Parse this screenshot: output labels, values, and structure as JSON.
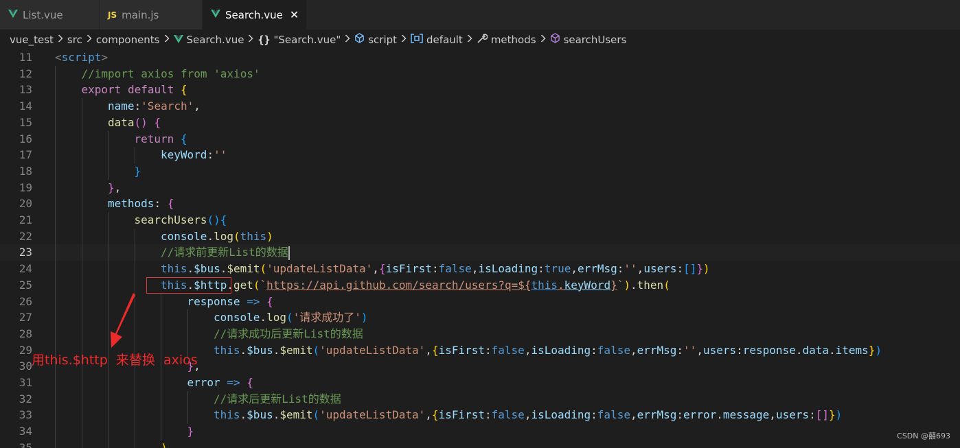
{
  "tabs": [
    {
      "label": "List.vue",
      "icon": "vue-icon",
      "active": false
    },
    {
      "label": "main.js",
      "icon": "js-icon",
      "active": false
    },
    {
      "label": "Search.vue",
      "icon": "vue-icon",
      "active": true
    }
  ],
  "tab_js_glyph": "JS",
  "tab_close_glyph": "✕",
  "breadcrumb": [
    {
      "label": "vue_test",
      "icon": ""
    },
    {
      "label": "src",
      "icon": ""
    },
    {
      "label": "components",
      "icon": ""
    },
    {
      "label": "Search.vue",
      "icon": "vue-icon"
    },
    {
      "label": "\"Search.vue\"",
      "icon": "braces-icon"
    },
    {
      "label": "script",
      "icon": "cube-icon"
    },
    {
      "label": "default",
      "icon": "module-icon"
    },
    {
      "label": "methods",
      "icon": "wrench-icon"
    },
    {
      "label": "searchUsers",
      "icon": "method-cube-icon"
    }
  ],
  "code": {
    "current_line": 23,
    "lines": [
      {
        "n": "11",
        "indent": 0,
        "t": [
          [
            "tag",
            "<"
          ],
          [
            "tagname",
            "script"
          ],
          [
            "tag",
            ">"
          ]
        ]
      },
      {
        "n": "12",
        "indent": 1,
        "t": [
          [
            "cm",
            "//import axios from 'axios'"
          ]
        ]
      },
      {
        "n": "13",
        "indent": 1,
        "t": [
          [
            "kw",
            "export"
          ],
          [
            "plain",
            " "
          ],
          [
            "kw",
            "default"
          ],
          [
            "plain",
            " "
          ],
          [
            "p1",
            "{"
          ]
        ]
      },
      {
        "n": "14",
        "indent": 2,
        "t": [
          [
            "prop",
            "name"
          ],
          [
            "plain",
            ":"
          ],
          [
            "str",
            "'Search'"
          ],
          [
            "plain",
            ","
          ]
        ]
      },
      {
        "n": "15",
        "indent": 2,
        "t": [
          [
            "fn",
            "data"
          ],
          [
            "p2",
            "()"
          ],
          [
            "plain",
            " "
          ],
          [
            "p2",
            "{"
          ]
        ]
      },
      {
        "n": "16",
        "indent": 3,
        "t": [
          [
            "kw",
            "return"
          ],
          [
            "plain",
            " "
          ],
          [
            "p3",
            "{"
          ]
        ]
      },
      {
        "n": "17",
        "indent": 4,
        "t": [
          [
            "prop",
            "keyWord"
          ],
          [
            "plain",
            ":"
          ],
          [
            "str",
            "''"
          ]
        ]
      },
      {
        "n": "18",
        "indent": 3,
        "t": [
          [
            "p3",
            "}"
          ]
        ]
      },
      {
        "n": "19",
        "indent": 2,
        "t": [
          [
            "p2",
            "}"
          ],
          [
            "plain",
            ","
          ]
        ]
      },
      {
        "n": "20",
        "indent": 2,
        "t": [
          [
            "prop",
            "methods"
          ],
          [
            "plain",
            ": "
          ],
          [
            "p2",
            "{"
          ]
        ]
      },
      {
        "n": "21",
        "indent": 3,
        "t": [
          [
            "fn",
            "searchUsers"
          ],
          [
            "p3",
            "()"
          ],
          [
            "p3",
            "{"
          ]
        ]
      },
      {
        "n": "22",
        "indent": 4,
        "t": [
          [
            "prop",
            "console"
          ],
          [
            "plain",
            "."
          ],
          [
            "fn",
            "log"
          ],
          [
            "p1",
            "("
          ],
          [
            "this",
            "this"
          ],
          [
            "p1",
            ")"
          ]
        ]
      },
      {
        "n": "23",
        "indent": 4,
        "t": [
          [
            "cm",
            "//请求前更新List的数据"
          ],
          [
            "cursor",
            ""
          ]
        ]
      },
      {
        "n": "24",
        "indent": 4,
        "t": [
          [
            "this",
            "this"
          ],
          [
            "plain",
            "."
          ],
          [
            "prop",
            "$bus"
          ],
          [
            "plain",
            "."
          ],
          [
            "fn",
            "$emit"
          ],
          [
            "p1",
            "("
          ],
          [
            "str",
            "'updateListData'"
          ],
          [
            "plain",
            ","
          ],
          [
            "p2",
            "{"
          ],
          [
            "prop",
            "isFirst"
          ],
          [
            "plain",
            ":"
          ],
          [
            "bool",
            "false"
          ],
          [
            "plain",
            ","
          ],
          [
            "prop",
            "isLoading"
          ],
          [
            "plain",
            ":"
          ],
          [
            "bool",
            "true"
          ],
          [
            "plain",
            ","
          ],
          [
            "prop",
            "errMsg"
          ],
          [
            "plain",
            ":"
          ],
          [
            "str",
            "''"
          ],
          [
            "plain",
            ","
          ],
          [
            "prop",
            "users"
          ],
          [
            "plain",
            ":"
          ],
          [
            "p3",
            "[]"
          ],
          [
            "p2",
            "}"
          ],
          [
            "p1",
            ")"
          ]
        ]
      },
      {
        "n": "25",
        "indent": 4,
        "t": [
          [
            "this",
            "this"
          ],
          [
            "plain",
            "."
          ],
          [
            "prop",
            "$http"
          ],
          [
            "plain",
            "."
          ],
          [
            "fn",
            "get"
          ],
          [
            "p1",
            "("
          ],
          [
            "str",
            "`"
          ],
          [
            "strlink",
            "https://api.github.com/search/users?q=${"
          ],
          [
            "thislink",
            "this"
          ],
          [
            "strlink",
            "."
          ],
          [
            "proplink",
            "keyWord"
          ],
          [
            "strlink",
            "}"
          ],
          [
            "str",
            "`"
          ],
          [
            "p1",
            ")"
          ],
          [
            "plain",
            "."
          ],
          [
            "fn",
            "then"
          ],
          [
            "p1",
            "("
          ]
        ]
      },
      {
        "n": "26",
        "indent": 5,
        "t": [
          [
            "prop",
            "response"
          ],
          [
            "plain",
            " "
          ],
          [
            "this",
            "=>"
          ],
          [
            "plain",
            " "
          ],
          [
            "p2",
            "{"
          ]
        ]
      },
      {
        "n": "27",
        "indent": 6,
        "t": [
          [
            "prop",
            "console"
          ],
          [
            "plain",
            "."
          ],
          [
            "fn",
            "log"
          ],
          [
            "p3",
            "("
          ],
          [
            "str",
            "'请求成功了'"
          ],
          [
            "p3",
            ")"
          ]
        ]
      },
      {
        "n": "28",
        "indent": 6,
        "t": [
          [
            "cm",
            "//请求成功后更新List的数据"
          ]
        ]
      },
      {
        "n": "29",
        "indent": 6,
        "t": [
          [
            "this",
            "this"
          ],
          [
            "plain",
            "."
          ],
          [
            "prop",
            "$bus"
          ],
          [
            "plain",
            "."
          ],
          [
            "fn",
            "$emit"
          ],
          [
            "p3",
            "("
          ],
          [
            "str",
            "'updateListData'"
          ],
          [
            "plain",
            ","
          ],
          [
            "p1",
            "{"
          ],
          [
            "prop",
            "isFirst"
          ],
          [
            "plain",
            ":"
          ],
          [
            "bool",
            "false"
          ],
          [
            "plain",
            ","
          ],
          [
            "prop",
            "isLoading"
          ],
          [
            "plain",
            ":"
          ],
          [
            "bool",
            "false"
          ],
          [
            "plain",
            ","
          ],
          [
            "prop",
            "errMsg"
          ],
          [
            "plain",
            ":"
          ],
          [
            "str",
            "''"
          ],
          [
            "plain",
            ","
          ],
          [
            "prop",
            "users"
          ],
          [
            "plain",
            ":"
          ],
          [
            "prop",
            "response"
          ],
          [
            "plain",
            "."
          ],
          [
            "prop",
            "data"
          ],
          [
            "plain",
            "."
          ],
          [
            "prop",
            "items"
          ],
          [
            "p1",
            "}"
          ],
          [
            "p3",
            ")"
          ]
        ]
      },
      {
        "n": "30",
        "indent": 5,
        "t": [
          [
            "p2",
            "}"
          ],
          [
            "plain",
            ","
          ]
        ]
      },
      {
        "n": "31",
        "indent": 5,
        "t": [
          [
            "prop",
            "error"
          ],
          [
            "plain",
            " "
          ],
          [
            "this",
            "=>"
          ],
          [
            "plain",
            " "
          ],
          [
            "p2",
            "{"
          ]
        ]
      },
      {
        "n": "32",
        "indent": 6,
        "t": [
          [
            "cm",
            "//请求后更新List的数据"
          ]
        ]
      },
      {
        "n": "33",
        "indent": 6,
        "t": [
          [
            "this",
            "this"
          ],
          [
            "plain",
            "."
          ],
          [
            "prop",
            "$bus"
          ],
          [
            "plain",
            "."
          ],
          [
            "fn",
            "$emit"
          ],
          [
            "p3",
            "("
          ],
          [
            "str",
            "'updateListData'"
          ],
          [
            "plain",
            ","
          ],
          [
            "p1",
            "{"
          ],
          [
            "prop",
            "isFirst"
          ],
          [
            "plain",
            ":"
          ],
          [
            "bool",
            "false"
          ],
          [
            "plain",
            ","
          ],
          [
            "prop",
            "isLoading"
          ],
          [
            "plain",
            ":"
          ],
          [
            "bool",
            "false"
          ],
          [
            "plain",
            ","
          ],
          [
            "prop",
            "errMsg"
          ],
          [
            "plain",
            ":"
          ],
          [
            "prop",
            "error"
          ],
          [
            "plain",
            "."
          ],
          [
            "prop",
            "message"
          ],
          [
            "plain",
            ","
          ],
          [
            "prop",
            "users"
          ],
          [
            "plain",
            ":"
          ],
          [
            "p2",
            "[]"
          ],
          [
            "p1",
            "}"
          ],
          [
            "p3",
            ")"
          ]
        ]
      },
      {
        "n": "34",
        "indent": 5,
        "t": [
          [
            "p2",
            "}"
          ]
        ]
      },
      {
        "n": "35",
        "indent": 4,
        "t": [
          [
            "p1",
            ")"
          ]
        ]
      }
    ]
  },
  "annotation": {
    "label": "用this.$http  来替换  axios",
    "color": "#ee2b2b"
  },
  "watermark": "CSDN @囍693",
  "colors": {
    "editor_bg": "#1e1e1e",
    "tab_bar_bg": "#252526",
    "vue_green": "#41b883",
    "js_yellow": "#f1d44a"
  }
}
